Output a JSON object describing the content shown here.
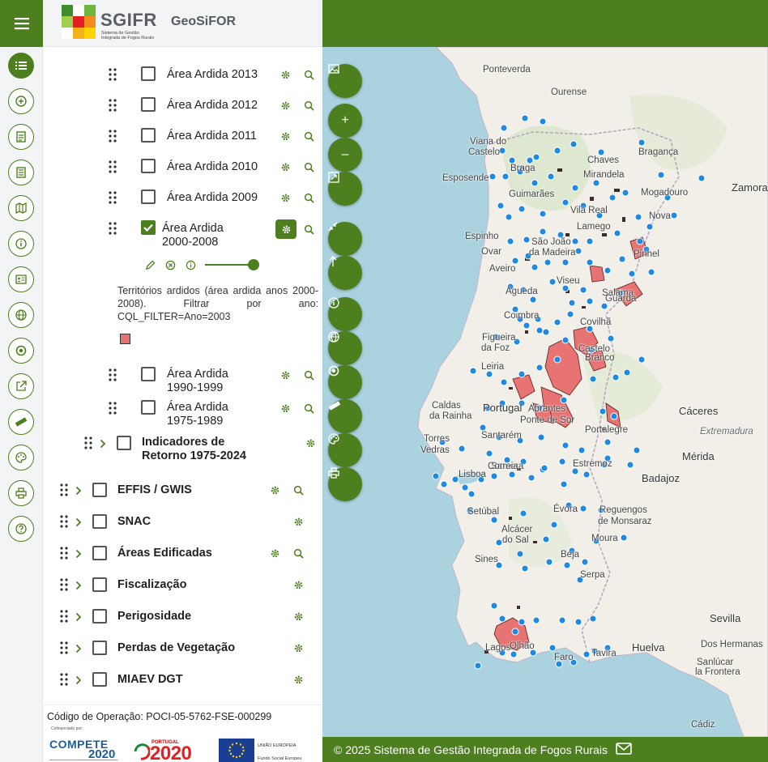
{
  "header": {
    "logo_name": "SGIFR",
    "logo_sub": "Sistema de Gestão Integrada de Fogos Rurais",
    "app_name": "GeoSiFOR"
  },
  "colors": {
    "brand_green": "#4d7f1f",
    "burned_area": "#e87373",
    "point": "#1e88e5",
    "water": "#aad3df",
    "land": "#f2efe9"
  },
  "rail": {
    "icons": [
      "list-icon",
      "plus-circle-icon",
      "document-icon",
      "document-lines-icon",
      "map-icon",
      "info-icon",
      "id-card-icon",
      "globe-icon",
      "target-icon",
      "export-icon",
      "ruler-icon",
      "palette-icon",
      "print-icon",
      "help-icon"
    ]
  },
  "layers": {
    "sub": [
      {
        "label": "Área Ardida 2013"
      },
      {
        "label": "Área Ardida 2012"
      },
      {
        "label": "Área Ardida 2011"
      },
      {
        "label": "Área Ardida 2010"
      },
      {
        "label": "Área Ardida 2009"
      }
    ],
    "active": {
      "line1": "Área Ardida",
      "line2": "2000-2008",
      "checked": true,
      "opacity": 1.0
    },
    "active_desc": "Territórios ardidos (área ardida anos 2000-2008). Filtrar por ano: CQL_FILTER=Ano=2003",
    "sub2": [
      {
        "line1": "Área Ardida",
        "line2": "1990-1999"
      },
      {
        "line1": "Área Ardida",
        "line2": "1975-1989"
      }
    ],
    "group_indicadores": {
      "line1": "Indicadores de",
      "line2": "Retorno 1975-2024"
    },
    "groups": [
      {
        "label": "EFFIS / GWIS",
        "zoom": true
      },
      {
        "label": "SNAC",
        "zoom": false
      },
      {
        "label": "Áreas Edificadas",
        "zoom": true
      },
      {
        "label": "Fiscalização",
        "zoom": false
      },
      {
        "label": "Perigosidade",
        "zoom": false
      },
      {
        "label": "Perdas de Vegetação",
        "zoom": false
      },
      {
        "label": "MIAEV DGT",
        "zoom": false
      }
    ]
  },
  "footer": {
    "code": "Código de Operação: POCI-05-5762-FSE-000299",
    "cofinanced": "Cofinanciado por:",
    "compete": "COMPETE",
    "compete_year": "2020",
    "portugal": "PORTUGAL",
    "portugal_year": "2020",
    "eu_line1": "UNIÃO EUROPEIA",
    "eu_line2": "Fundo Social Europeu"
  },
  "map": {
    "buttons": [
      "image-icon",
      "zoom-in-icon",
      "zoom-out-icon",
      "extent-icon",
      "collapse-icon",
      "up-arrow-icon",
      "info-icon",
      "globe-icon",
      "target-icon",
      "ruler-icon",
      "palette-icon",
      "print-icon"
    ],
    "zoom_in": "+",
    "zoom_out": "–",
    "places": [
      {
        "name": "Ponteverda"
      },
      {
        "name": "Ourense"
      },
      {
        "name": "Viana do"
      },
      {
        "name": "Castelo"
      },
      {
        "name": "Braga"
      },
      {
        "name": "Esposende"
      },
      {
        "name": "Chaves"
      },
      {
        "name": "Bragança"
      },
      {
        "name": "Mirandela"
      },
      {
        "name": "Zamora"
      },
      {
        "name": "Guimarães"
      },
      {
        "name": "Mogadouro"
      },
      {
        "name": "Vila Real"
      },
      {
        "name": "Nova"
      },
      {
        "name": "Espinho"
      },
      {
        "name": "Lamego"
      },
      {
        "name": "São João"
      },
      {
        "name": "da Madeira"
      },
      {
        "name": "Ovar"
      },
      {
        "name": "Pinhel"
      },
      {
        "name": "Aveiro"
      },
      {
        "name": "Viseu"
      },
      {
        "name": "Salama"
      },
      {
        "name": "Águeda"
      },
      {
        "name": "Coimbra"
      },
      {
        "name": "Guarda"
      },
      {
        "name": "Covilhã"
      },
      {
        "name": "Figueira"
      },
      {
        "name": "da Foz"
      },
      {
        "name": "Castelo"
      },
      {
        "name": "Branco"
      },
      {
        "name": "Leiria"
      },
      {
        "name": "Caldas"
      },
      {
        "name": "da Rainha"
      },
      {
        "name": "Portugal"
      },
      {
        "name": "Abrantes"
      },
      {
        "name": "Ponte de Sor"
      },
      {
        "name": "Portalegre"
      },
      {
        "name": "Cáceres"
      },
      {
        "name": "Extremadura"
      },
      {
        "name": "Torres"
      },
      {
        "name": "Vedras"
      },
      {
        "name": "Santarém"
      },
      {
        "name": "Mérida"
      },
      {
        "name": "Lisboa"
      },
      {
        "name": "Samora"
      },
      {
        "name": "Correia"
      },
      {
        "name": "Estremoz"
      },
      {
        "name": "Badajoz"
      },
      {
        "name": "Setúbal"
      },
      {
        "name": "Évora"
      },
      {
        "name": "Reguengos"
      },
      {
        "name": "de Monsaraz"
      },
      {
        "name": "Alcácer"
      },
      {
        "name": "do Sal"
      },
      {
        "name": "Moura"
      },
      {
        "name": "Sines"
      },
      {
        "name": "Beja"
      },
      {
        "name": "Serpa"
      },
      {
        "name": "Sevilla"
      },
      {
        "name": "Dos Hermanas"
      },
      {
        "name": "Lagos"
      },
      {
        "name": "Olhão"
      },
      {
        "name": "Faro"
      },
      {
        "name": "Tavira"
      },
      {
        "name": "Huelva"
      },
      {
        "name": "Sanlúcar"
      },
      {
        "name": "la Frontera"
      },
      {
        "name": "Cádiz"
      }
    ]
  },
  "map_footer": {
    "text": "© 2025 Sistema de Gestão Integrada de Fogos Rurais"
  }
}
